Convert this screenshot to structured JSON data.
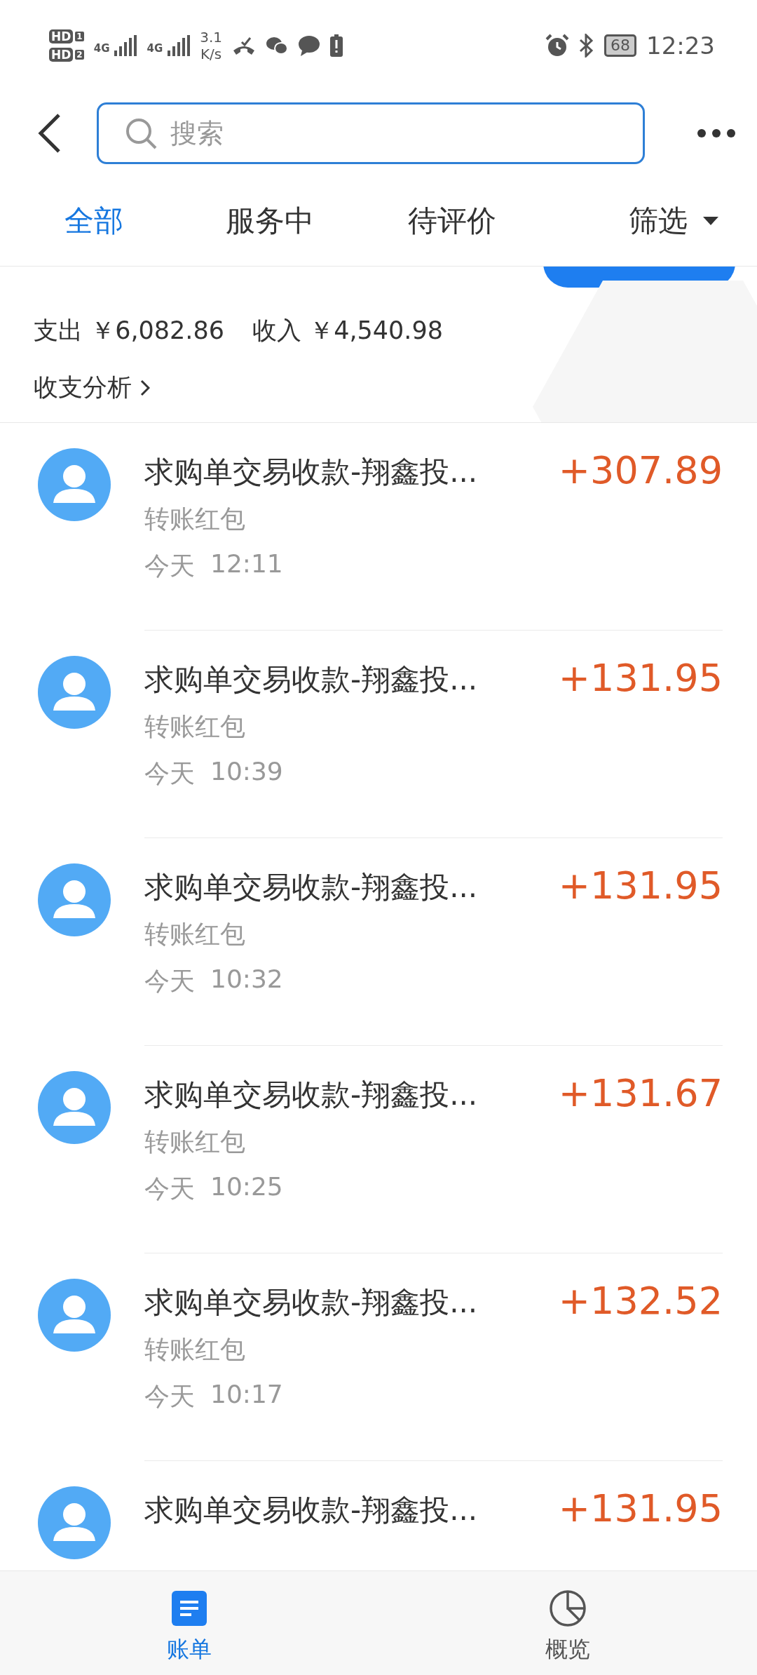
{
  "status_bar": {
    "sims": [
      {
        "label": "HD",
        "slot": "1"
      },
      {
        "label": "HD",
        "slot": "2"
      }
    ],
    "networks": [
      "4G",
      "4G"
    ],
    "speed": [
      "3.1",
      "K/s"
    ],
    "battery": "68",
    "time": "12:23"
  },
  "search": {
    "placeholder": "搜索"
  },
  "tabs": [
    {
      "label": "全部",
      "selected": true
    },
    {
      "label": "服务中",
      "selected": false
    },
    {
      "label": "待评价",
      "selected": false
    }
  ],
  "filter": {
    "label": "筛选"
  },
  "summary": {
    "expense_label": "支出",
    "expense": "￥6,082.86",
    "income_label": "收入",
    "income": "￥4,540.98",
    "analysis": "收支分析"
  },
  "transactions": [
    {
      "title": "求购单交易收款-翔鑫投...",
      "amount": "+307.89",
      "category": "转账红包",
      "day": "今天",
      "time": "12:11"
    },
    {
      "title": "求购单交易收款-翔鑫投...",
      "amount": "+131.95",
      "category": "转账红包",
      "day": "今天",
      "time": "10:39"
    },
    {
      "title": "求购单交易收款-翔鑫投...",
      "amount": "+131.95",
      "category": "转账红包",
      "day": "今天",
      "time": "10:32"
    },
    {
      "title": "求购单交易收款-翔鑫投...",
      "amount": "+131.67",
      "category": "转账红包",
      "day": "今天",
      "time": "10:25"
    },
    {
      "title": "求购单交易收款-翔鑫投...",
      "amount": "+132.52",
      "category": "转账红包",
      "day": "今天",
      "time": "10:17"
    },
    {
      "title": "求购单交易收款-翔鑫投...",
      "amount": "+131.95"
    }
  ],
  "bottom_nav": [
    {
      "label": "账单",
      "kind": "bill",
      "selected": true
    },
    {
      "label": "概览",
      "kind": "chart",
      "selected": false
    }
  ]
}
